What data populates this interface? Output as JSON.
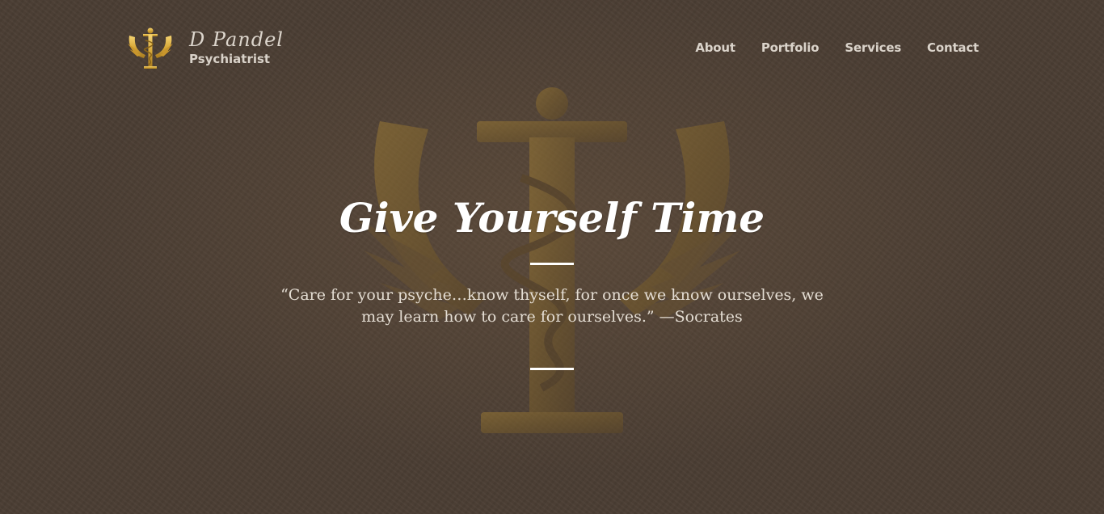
{
  "brand": {
    "name": "D Pandel",
    "role": "Psychiatrist",
    "logo_icon": "psi-caduceus-winged-icon"
  },
  "nav": {
    "items": [
      {
        "label": "About"
      },
      {
        "label": "Portfolio"
      },
      {
        "label": "Services"
      },
      {
        "label": "Contact"
      }
    ]
  },
  "hero": {
    "title": "Give Yourself Time",
    "quote": "“Care for your psyche…know thyself, for once we know ourselves, we may learn how to care for ourselves.” —Socrates"
  },
  "colors": {
    "background": "#4a3d33",
    "gold_accent": "#c9a24a",
    "text_light": "#e4ddd3",
    "title_white": "#ffffff"
  }
}
